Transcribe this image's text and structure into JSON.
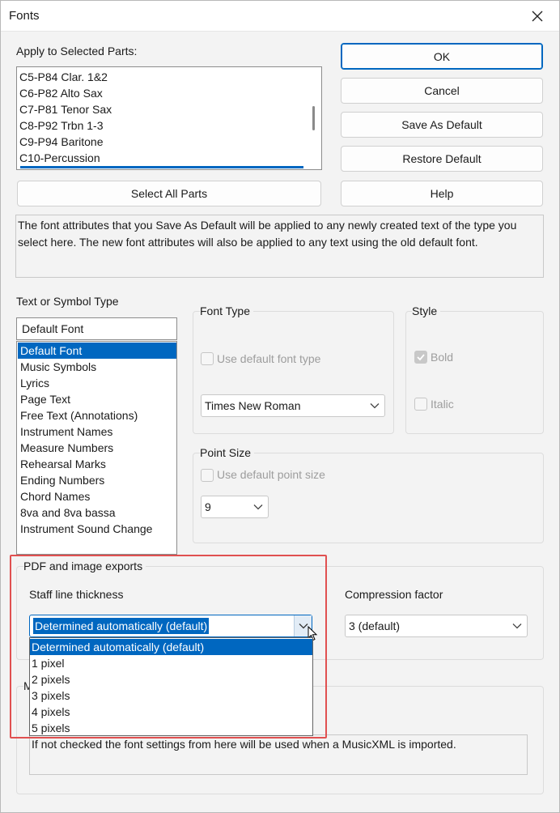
{
  "window": {
    "title": "Fonts"
  },
  "parts": {
    "label": "Apply to Selected Parts:",
    "items": [
      "C5-P84 Clar. 1&2",
      "C6-P82 Alto Sax",
      "C7-P81 Tenor Sax",
      "C8-P92 Trbn 1-3",
      "C9-P94 Baritone",
      "C10-Percussion"
    ],
    "select_all_label": "Select All Parts"
  },
  "buttons": {
    "ok": "OK",
    "cancel": "Cancel",
    "save_default": "Save As Default",
    "restore_default": "Restore Default",
    "help": "Help"
  },
  "info_text": "The font attributes that you Save As Default will be applied to any newly created text of the type you select here.   The new font attributes will also be applied to any text using the old default font.",
  "text_type": {
    "label": "Text or Symbol Type",
    "current": "Default Font",
    "items": [
      "Default Font",
      "Music Symbols",
      "Lyrics",
      "Page Text",
      "Free Text (Annotations)",
      "Instrument Names",
      "Measure Numbers",
      "Rehearsal Marks",
      "Ending Numbers",
      "Chord Names",
      "8va and 8va bassa",
      "Instrument Sound Change"
    ],
    "selected_index": 0
  },
  "font_type": {
    "title": "Font Type",
    "use_default_label": "Use default font type",
    "font_value": "Times New Roman"
  },
  "style": {
    "title": "Style",
    "bold_label": "Bold",
    "bold_checked": true,
    "italic_label": "Italic",
    "italic_checked": false
  },
  "point_size": {
    "title": "Point Size",
    "use_default_label": "Use default point size",
    "value": "9"
  },
  "exports": {
    "title": "PDF and image exports",
    "staff_label": "Staff line thickness",
    "staff_value": "Determined automatically (default)",
    "staff_options": [
      "Determined automatically (default)",
      "1 pixel",
      "2 pixels",
      "3 pixels",
      "4 pixels",
      "5 pixels"
    ],
    "compression_label": "Compression factor",
    "compression_value": "3  (default)"
  },
  "musicxml": {
    "title_partial": "M",
    "note": "If not checked the font settings from here will be used when a MusicXML is imported."
  },
  "colors": {
    "accent": "#0067c0",
    "highlight": "#e05050"
  }
}
